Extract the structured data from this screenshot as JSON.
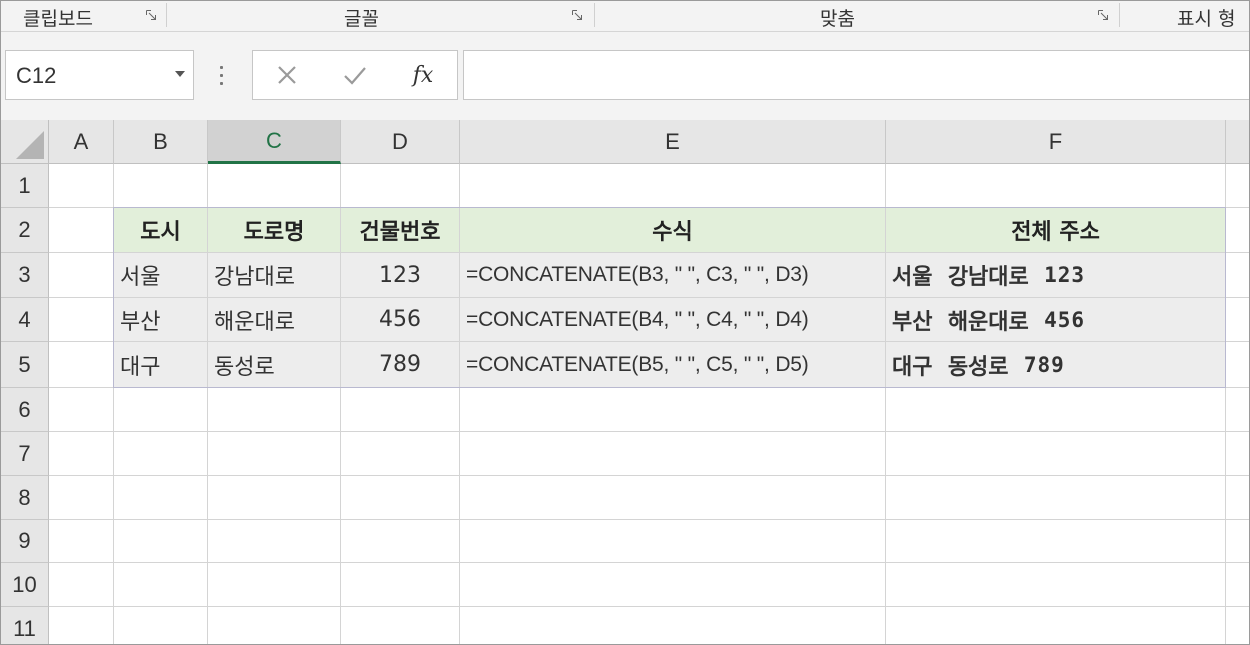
{
  "ribbon": {
    "groups": [
      {
        "label": "클립보드"
      },
      {
        "label": "글꼴"
      },
      {
        "label": "맞춤"
      },
      {
        "label": "표시 형"
      }
    ]
  },
  "formula_bar": {
    "name_box": "C12",
    "formula": "",
    "icons": [
      "cancel-icon",
      "enter-icon",
      "fx-icon"
    ]
  },
  "grid": {
    "columns": [
      "A",
      "B",
      "C",
      "D",
      "E",
      "F"
    ],
    "selected_column": "C",
    "rows": [
      "1",
      "2",
      "3",
      "4",
      "5",
      "6",
      "7",
      "8",
      "9",
      "10",
      "11"
    ],
    "table_header": {
      "city": "도시",
      "road": "도로명",
      "building_no": "건물번호",
      "formula": "수식",
      "full_address": "전체 주소"
    },
    "table_rows": [
      {
        "city": "서울",
        "road": "강남대로",
        "building_no": "123",
        "formula": "=CONCATENATE(B3, \" \", C3, \" \", D3)",
        "full_city": "서울",
        "full_road": "강남대로",
        "full_no": "123"
      },
      {
        "city": "부산",
        "road": "해운대로",
        "building_no": "456",
        "formula": "=CONCATENATE(B4, \" \", C4, \" \", D4)",
        "full_city": "부산",
        "full_road": "해운대로",
        "full_no": "456"
      },
      {
        "city": "대구",
        "road": "동성로",
        "building_no": "789",
        "formula": "=CONCATENATE(B5, \" \", C5, \" \", D5)",
        "full_city": "대구",
        "full_road": "동성로",
        "full_no": "789"
      }
    ]
  },
  "colors": {
    "header_fill": "#e2efda",
    "body_fill": "#ededed",
    "selected_column_accent": "#217346"
  }
}
